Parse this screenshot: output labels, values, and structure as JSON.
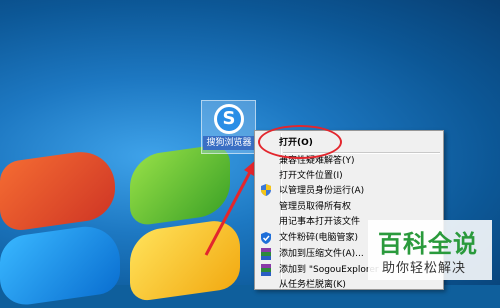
{
  "desktop": {
    "icon_label": "搜狗浏览器",
    "icon_glyph": "S"
  },
  "context_menu": {
    "items": [
      "打开(O)",
      "兼容性疑难解答(Y)",
      "打开文件位置(I)",
      "以管理员身份运行(A)",
      "管理员取得所有权",
      "用记事本打开该文件",
      "文件粉碎(电脑管家)",
      "添加到压缩文件(A)...",
      "添加到 \"SogouExplorer",
      "从任务栏脱离(K)"
    ]
  },
  "watermark": {
    "title": "百科全说",
    "subtitle": "助你轻松解决"
  },
  "colors": {
    "highlight": "#e3262d",
    "watermark_green": "#2a9a3c"
  }
}
